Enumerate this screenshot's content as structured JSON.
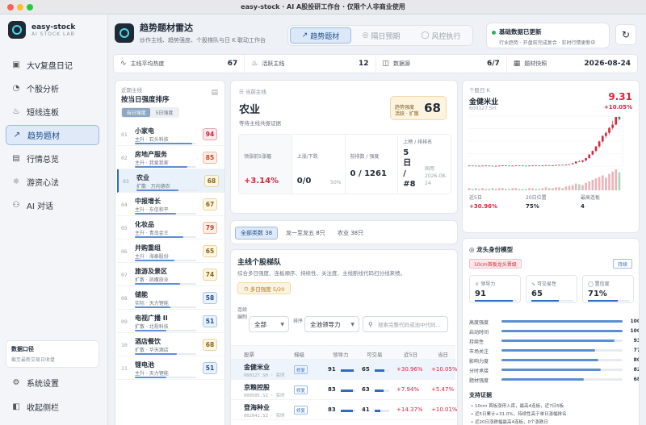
{
  "window": {
    "title": "easy-stock · AI A股投研工作台 · 仅限个人非商业使用"
  },
  "colors": {
    "accent": "#2d6cc0",
    "up": "#d7263d",
    "down": "#1e9b55",
    "gold": "#b07a1a"
  },
  "sidebar": {
    "brand_name": "easy-stock",
    "brand_sub": "AI STOCK LAB",
    "items": [
      {
        "label": "大V复盘日记",
        "icon": "book-icon"
      },
      {
        "label": "个股分析",
        "icon": "gauge-icon"
      },
      {
        "label": "短线连板",
        "icon": "flame-icon"
      },
      {
        "label": "趋势题材",
        "icon": "trend-icon",
        "active": true
      },
      {
        "label": "行情总览",
        "icon": "chart-icon"
      },
      {
        "label": "游资心法",
        "icon": "lightbulb-icon"
      },
      {
        "label": "AI 对话",
        "icon": "robot-icon"
      }
    ],
    "source_title": "数据口径",
    "source_desc": "截至最新交易日收盘",
    "settings": "系统设置",
    "collapse": "收起侧栏"
  },
  "header": {
    "title": "趋势题材雷达",
    "subtitle": "炒作主线、趋势强度、个股梯队与日 K 联动工作台",
    "tabs": [
      "趋势题材",
      "隔日预期",
      "风控执行"
    ],
    "update_title": "基础数据已更新",
    "update_desc": "行业趋势 · 开盘前完成复合 · 实时行情更新中"
  },
  "stats": [
    {
      "label": "主线平均热度",
      "value": "67"
    },
    {
      "label": "活跃主线",
      "value": "12"
    },
    {
      "label": "数据源",
      "value": "6/7"
    },
    {
      "label": "题材快照",
      "value": "2026-08-24"
    }
  ],
  "ranking": {
    "hint": "近期主线",
    "title": "按当日强度排序",
    "seg": [
      "当日强度",
      "5日强度"
    ],
    "items": [
      {
        "no": "01",
        "name": "小家电",
        "sub": "主升 · 石头科技",
        "score": "94",
        "pct": 94
      },
      {
        "no": "02",
        "name": "房地产服务",
        "sub": "主升 · 我爱我家",
        "score": "85",
        "pct": 85
      },
      {
        "no": "03",
        "name": "农业",
        "sub": "扩散 · 万向德农",
        "score": "68",
        "pct": 68,
        "selected": true
      },
      {
        "no": "04",
        "name": "中报增长",
        "sub": "主升 · 东信和平",
        "score": "67",
        "pct": 67
      },
      {
        "no": "05",
        "name": "化妆品",
        "sub": "主升 · 青岛金王",
        "score": "79",
        "pct": 79
      },
      {
        "no": "06",
        "name": "并购重组",
        "sub": "主升 · 海泰股份",
        "score": "65",
        "pct": 65
      },
      {
        "no": "07",
        "name": "旅游及景区",
        "sub": "扩散 · 凯撒旅业",
        "score": "74",
        "pct": 74
      },
      {
        "no": "08",
        "name": "储能",
        "sub": "实际 · 天力锂能",
        "score": "58",
        "pct": 58
      },
      {
        "no": "09",
        "name": "电视广播 II",
        "sub": "扩散 · 北视科技",
        "score": "51",
        "pct": 51
      },
      {
        "no": "10",
        "name": "酒店餐饮",
        "sub": "扩散 · 华天酒店",
        "score": "68",
        "pct": 68
      },
      {
        "no": "11",
        "name": "锂电池",
        "sub": "主升 · 天力锂能",
        "score": "51",
        "pct": 51
      }
    ]
  },
  "sector": {
    "hint": "当前主线",
    "name": "农业",
    "desc": "等待主线共振证据",
    "strength_l1": "趋势强度",
    "strength_l2": "活跃 · 扩散",
    "strength": "68",
    "cells": [
      {
        "label": "领涨前5涨幅",
        "value": "+3.14%"
      },
      {
        "label": "上涨/下跌",
        "value": "0/0",
        "extra": "50%"
      },
      {
        "label": "前排数 / 强度",
        "value": "0 / 1261"
      },
      {
        "label": "上榜 / 排排名",
        "value": "5 日 / #8",
        "extra": "国用 2026-08-24"
      }
    ]
  },
  "filter": {
    "chips": [
      "全部类数 38",
      "龙一至龙五 8只",
      "农业 38只"
    ]
  },
  "ladder": {
    "title": "主线个股梯队",
    "desc": "综合多日强度、连板顺序、持续性、关注度、主线断线代码扫分线来绩。",
    "badge": "多日强度 5/20",
    "f1_label": "连续编制",
    "f1_value": "全部",
    "f2_label": "排序",
    "f2_value": "全池领导力",
    "search_ph": "搜索完整代码或池中代码...",
    "cols": [
      "股票",
      "梯级",
      "领导力",
      "可交易",
      "近5日",
      "当日"
    ],
    "rows": [
      {
        "name": "金健米业",
        "code": "600127.SH · 实时",
        "tag": "修复",
        "lead": "91",
        "lpct": 91,
        "trade": "65",
        "tpct": 65,
        "d5": "+30.96%",
        "d1": "+10.05%"
      },
      {
        "name": "京粮控股",
        "code": "000505.SZ · 实时",
        "tag": "修复",
        "lead": "83",
        "lpct": 83,
        "trade": "63",
        "tpct": 63,
        "d5": "+7.94%",
        "d1": "+5.47%"
      },
      {
        "name": "登海种业",
        "code": "002041.SZ · 实时",
        "tag": "修复",
        "lead": "83",
        "lpct": 83,
        "trade": "41",
        "tpct": 41,
        "d5": "+14.37%",
        "d1": "+10.01%"
      }
    ]
  },
  "quote": {
    "hint": "个股日 K",
    "name": "金健米业",
    "code": "600127.SH",
    "price": "9.31",
    "change": "+10.05%",
    "footer": [
      {
        "label": "近5日",
        "value": "+30.96%"
      },
      {
        "label": "20日位置",
        "value": "75%"
      },
      {
        "label": "最高连板",
        "value": "4"
      }
    ],
    "candles": [
      [
        3.92,
        3.94,
        3.9,
        3.93
      ],
      [
        3.93,
        3.95,
        3.91,
        3.92
      ],
      [
        3.92,
        3.93,
        3.89,
        3.9
      ],
      [
        3.9,
        3.92,
        3.88,
        3.91
      ],
      [
        3.91,
        3.93,
        3.9,
        3.92
      ],
      [
        3.92,
        3.94,
        3.91,
        3.93
      ],
      [
        3.93,
        3.94,
        3.9,
        3.91
      ],
      [
        3.91,
        3.92,
        3.88,
        3.89
      ],
      [
        3.89,
        3.91,
        3.87,
        3.9
      ],
      [
        3.9,
        3.93,
        3.89,
        3.92
      ],
      [
        3.92,
        3.95,
        3.91,
        3.94
      ],
      [
        3.94,
        3.96,
        3.92,
        3.93
      ],
      [
        3.93,
        3.94,
        3.9,
        3.91
      ],
      [
        3.91,
        3.93,
        3.9,
        3.92
      ],
      [
        3.92,
        3.96,
        3.91,
        3.95
      ],
      [
        3.95,
        3.97,
        3.93,
        3.94
      ],
      [
        3.94,
        3.95,
        3.91,
        3.92
      ],
      [
        3.92,
        3.93,
        3.9,
        3.91
      ],
      [
        3.91,
        3.94,
        3.9,
        3.93
      ],
      [
        3.93,
        3.95,
        3.92,
        3.94
      ],
      [
        3.94,
        3.96,
        3.92,
        3.93
      ],
      [
        3.93,
        3.94,
        3.91,
        3.92
      ],
      [
        3.92,
        3.95,
        3.91,
        3.94
      ],
      [
        3.94,
        3.98,
        3.93,
        3.97
      ],
      [
        3.97,
        3.99,
        3.94,
        3.95
      ],
      [
        3.95,
        3.97,
        3.93,
        3.96
      ],
      [
        3.96,
        4.0,
        3.95,
        3.99
      ],
      [
        3.99,
        4.02,
        3.97,
        4.01
      ],
      [
        4.01,
        4.03,
        3.98,
        3.99
      ],
      [
        3.99,
        4.04,
        3.98,
        4.03
      ],
      [
        4.03,
        4.1,
        4.01,
        4.08
      ],
      [
        4.08,
        4.2,
        4.06,
        4.18
      ],
      [
        4.18,
        4.4,
        4.15,
        4.38
      ],
      [
        4.38,
        4.6,
        4.3,
        4.35
      ],
      [
        4.35,
        4.55,
        4.25,
        4.5
      ],
      [
        4.5,
        4.8,
        4.4,
        4.75
      ],
      [
        4.75,
        5.2,
        4.7,
        5.15
      ],
      [
        5.15,
        5.6,
        5.05,
        5.55
      ],
      [
        5.55,
        6.1,
        5.4,
        6.05
      ],
      [
        6.05,
        6.7,
        5.9,
        6.6
      ],
      [
        6.6,
        7.3,
        6.4,
        7.2
      ],
      [
        7.2,
        7.7,
        6.95,
        7.55
      ],
      [
        7.55,
        8.2,
        7.3,
        8.1
      ],
      [
        8.1,
        8.9,
        7.9,
        8.46
      ],
      [
        8.46,
        9.31,
        8.4,
        9.31
      ],
      [
        9.31,
        9.4,
        8.9,
        9.05
      ]
    ],
    "volumes": [
      3,
      2,
      3,
      2,
      3,
      2,
      2,
      3,
      2,
      3,
      3,
      2,
      2,
      3,
      3,
      2,
      2,
      2,
      3,
      3,
      2,
      2,
      3,
      4,
      3,
      3,
      4,
      4,
      3,
      5,
      6,
      7,
      9,
      8,
      7,
      10,
      12,
      14,
      16,
      18,
      20,
      17,
      22,
      25,
      28,
      24
    ]
  },
  "dragon": {
    "title": "龙头身份模型",
    "chips": [
      "10cm首板龙头晋级",
      "持续"
    ],
    "boxes": [
      {
        "label": "领导力",
        "value": "91",
        "pct": 91
      },
      {
        "label": "可交易性",
        "value": "65",
        "pct": 65
      },
      {
        "label": "置信度",
        "value": "71%",
        "pct": 71
      }
    ],
    "metrics": [
      {
        "label": "高度强度",
        "value": "100",
        "pct": 100
      },
      {
        "label": "启动时间",
        "value": "100",
        "pct": 100
      },
      {
        "label": "持续性",
        "value": "93",
        "pct": 93
      },
      {
        "label": "市场关注",
        "value": "77",
        "pct": 77
      },
      {
        "label": "影响力度",
        "value": "80",
        "pct": 80
      },
      {
        "label": "分时承接",
        "value": "82",
        "pct": 82
      },
      {
        "label": "题材强度",
        "value": "68",
        "pct": 68
      }
    ],
    "evidence_title": "支持证据",
    "evidence": [
      "10cm 首板涨停入库，最高4连板，近7日5板",
      "近5日累计+31.0%，持续性高于单日涨幅排名",
      "近20日涨跌幅最高4连板，0个涨跌日",
      "涨跌幅日内稳定承接，对应题材中期持续"
    ]
  }
}
